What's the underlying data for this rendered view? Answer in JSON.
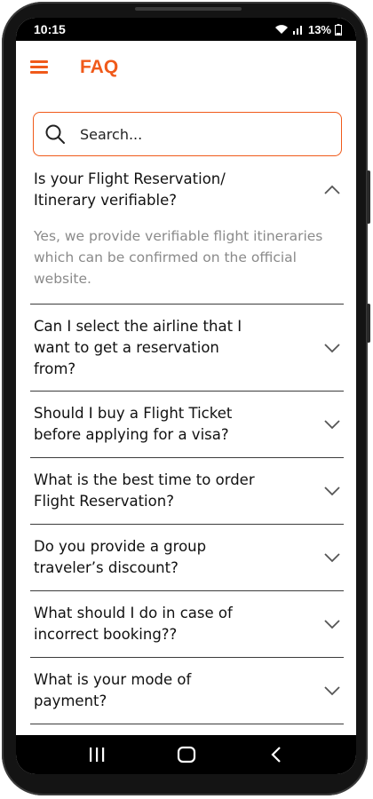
{
  "status_bar": {
    "time": "10:15",
    "battery": "13%"
  },
  "appbar": {
    "title": "FAQ"
  },
  "search": {
    "placeholder": "Search..."
  },
  "faqs": [
    {
      "question": "Is your Flight Reservation/ Itinerary verifiable?",
      "expanded": true,
      "answer": "Yes, we provide verifiable flight itineraries which can be confirmed on the official website."
    },
    {
      "question": "Can I select the airline that I want to get a reservation from?",
      "expanded": false
    },
    {
      "question": "Should I buy a Flight Ticket before applying for a visa?",
      "expanded": false
    },
    {
      "question": "What is the best time to order Flight Reservation?",
      "expanded": false
    },
    {
      "question": "Do you provide a group traveler’s discount?",
      "expanded": false
    },
    {
      "question": "What should I do in case of incorrect booking??",
      "expanded": false
    },
    {
      "question": "What is your mode of payment?",
      "expanded": false
    }
  ],
  "colors": {
    "accent": "#f05a1a",
    "answer_text": "#8a8a8a",
    "divider": "#3c3c3c"
  },
  "icons": {
    "menu": "hamburger-icon",
    "search": "search-icon",
    "collapse": "chevron-up-icon",
    "expand": "chevron-down-icon",
    "recents": "recents-icon",
    "home": "home-icon",
    "back": "back-icon"
  }
}
